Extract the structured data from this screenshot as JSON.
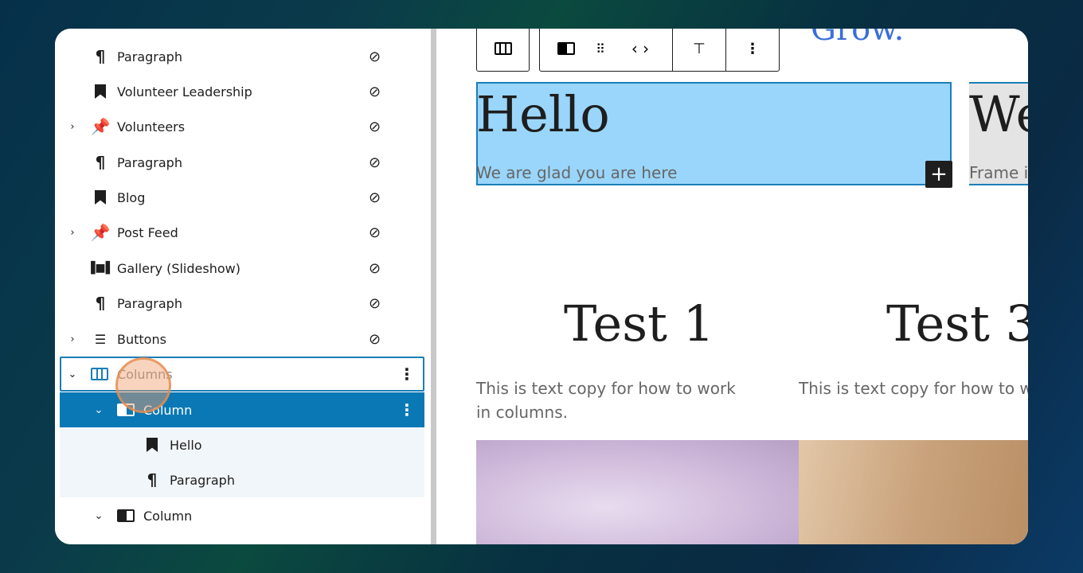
{
  "list_view": {
    "rows": [
      {
        "label": "Paragraph",
        "icon": "paragraph-icon",
        "hidden": true
      },
      {
        "label": "Volunteer Leadership",
        "icon": "bookmark-icon",
        "hidden": true
      },
      {
        "label": "Volunteers",
        "icon": "pin-icon",
        "hidden": true,
        "expandable": true
      },
      {
        "label": "Paragraph",
        "icon": "paragraph-icon",
        "hidden": true
      },
      {
        "label": "Blog",
        "icon": "bookmark-icon",
        "hidden": true
      },
      {
        "label": "Post Feed",
        "icon": "pin-icon",
        "hidden": true,
        "expandable": true
      },
      {
        "label": "Gallery (Slideshow)",
        "icon": "gallery-icon",
        "hidden": true
      },
      {
        "label": "Paragraph",
        "icon": "paragraph-icon",
        "hidden": true
      },
      {
        "label": "Buttons",
        "icon": "buttons-icon",
        "hidden": true,
        "expandable": true
      },
      {
        "label": "Columns",
        "icon": "columns-icon",
        "expanded": true
      },
      {
        "label": "Column",
        "icon": "column-icon",
        "expanded": true,
        "selected": true
      },
      {
        "label": "Hello",
        "icon": "bookmark-icon"
      },
      {
        "label": "Paragraph",
        "icon": "paragraph-icon"
      },
      {
        "label": "Column",
        "icon": "column-icon",
        "expanded": true
      }
    ]
  },
  "canvas": {
    "top_heading": "Grow.",
    "col1_heading": "Hello",
    "col1_text": "We are glad you are here",
    "col2_heading": "We",
    "col2_text": "Frame i",
    "test1_heading": "Test 1",
    "test1_text": "This is text copy for how to work in columns.",
    "test3_heading": "Test 3",
    "test3_text": "This is text copy for how to w in columns."
  },
  "colors": {
    "accent": "#0a78b5",
    "selection": "#9ad6fb"
  }
}
